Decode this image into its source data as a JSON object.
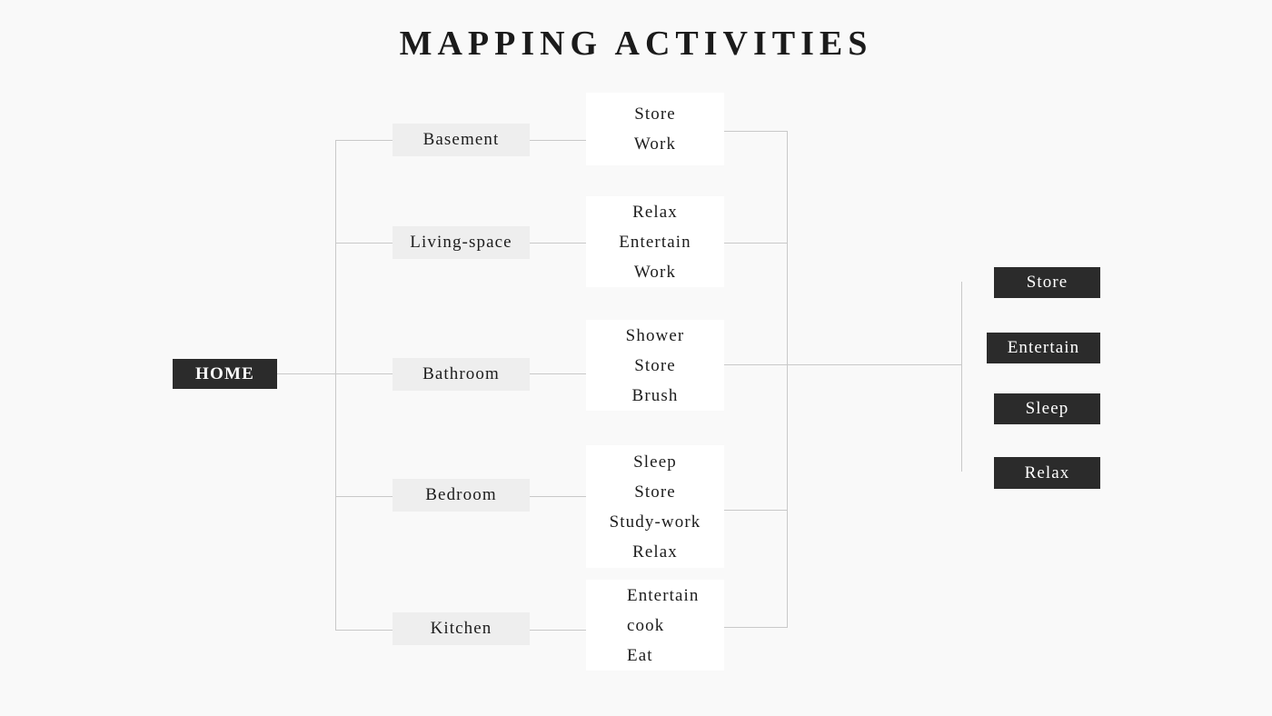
{
  "page": {
    "title": "MAPPING ACTIVITIES",
    "background_color": "#f9f9f9",
    "line_color": "#c9c9c9",
    "dark_color": "#2b2b2b",
    "room_chip_color": "#eeeeee",
    "activity_box_color": "#ffffff"
  },
  "root": {
    "label": "HOME"
  },
  "branches": [
    {
      "room": "Basement",
      "activities": [
        "Store",
        "Work"
      ],
      "align": "center"
    },
    {
      "room": "Living-space",
      "activities": [
        "Relax",
        "Entertain",
        "Work"
      ],
      "align": "center"
    },
    {
      "room": "Bathroom",
      "activities": [
        "Shower",
        "Store",
        "Brush"
      ],
      "align": "center"
    },
    {
      "room": "Bedroom",
      "activities": [
        "Sleep",
        "Store",
        "Study-work",
        "Relax"
      ],
      "align": "center"
    },
    {
      "room": "Kitchen",
      "activities": [
        "Entertain",
        "cook",
        "Eat"
      ],
      "align": "left"
    }
  ],
  "summary": {
    "items": [
      {
        "label": "Store"
      },
      {
        "label": "Entertain"
      },
      {
        "label": "Sleep"
      },
      {
        "label": "Relax"
      }
    ]
  }
}
